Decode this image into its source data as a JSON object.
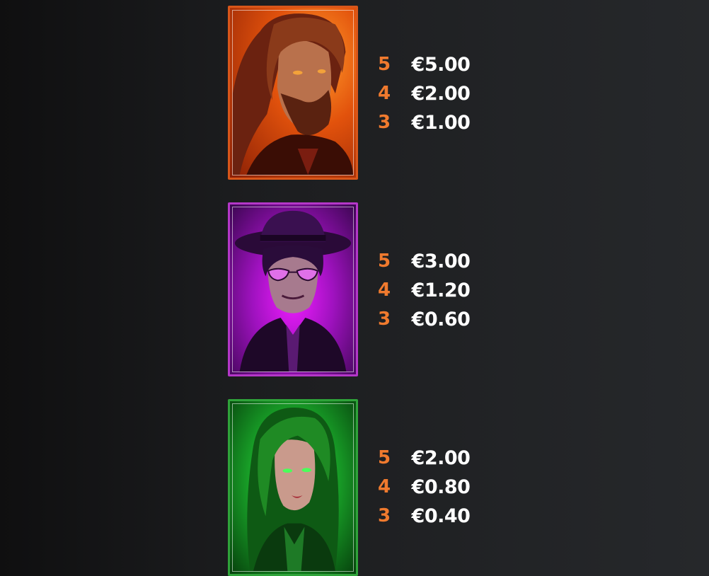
{
  "symbols": [
    {
      "name": "red-outlaw",
      "icon": "bearded-man-portrait-icon",
      "frame_color": "#d8561a",
      "glow_color": "#ff6a00",
      "payouts": [
        {
          "count": "5",
          "value": "€5.00"
        },
        {
          "count": "4",
          "value": "€2.00"
        },
        {
          "count": "3",
          "value": "€1.00"
        }
      ]
    },
    {
      "name": "purple-gangster",
      "icon": "man-with-hat-portrait-icon",
      "frame_color": "#b437c8",
      "glow_color": "#e81cff",
      "payouts": [
        {
          "count": "5",
          "value": "€3.00"
        },
        {
          "count": "4",
          "value": "€1.20"
        },
        {
          "count": "3",
          "value": "€0.60"
        }
      ]
    },
    {
      "name": "green-witch",
      "icon": "green-haired-woman-portrait-icon",
      "frame_color": "#2fa33a",
      "glow_color": "#36e04a",
      "payouts": [
        {
          "count": "5",
          "value": "€2.00"
        },
        {
          "count": "4",
          "value": "€0.80"
        },
        {
          "count": "3",
          "value": "€0.40"
        }
      ]
    }
  ],
  "colors": {
    "count_text": "#f07a2e",
    "value_text": "#ffffff"
  }
}
